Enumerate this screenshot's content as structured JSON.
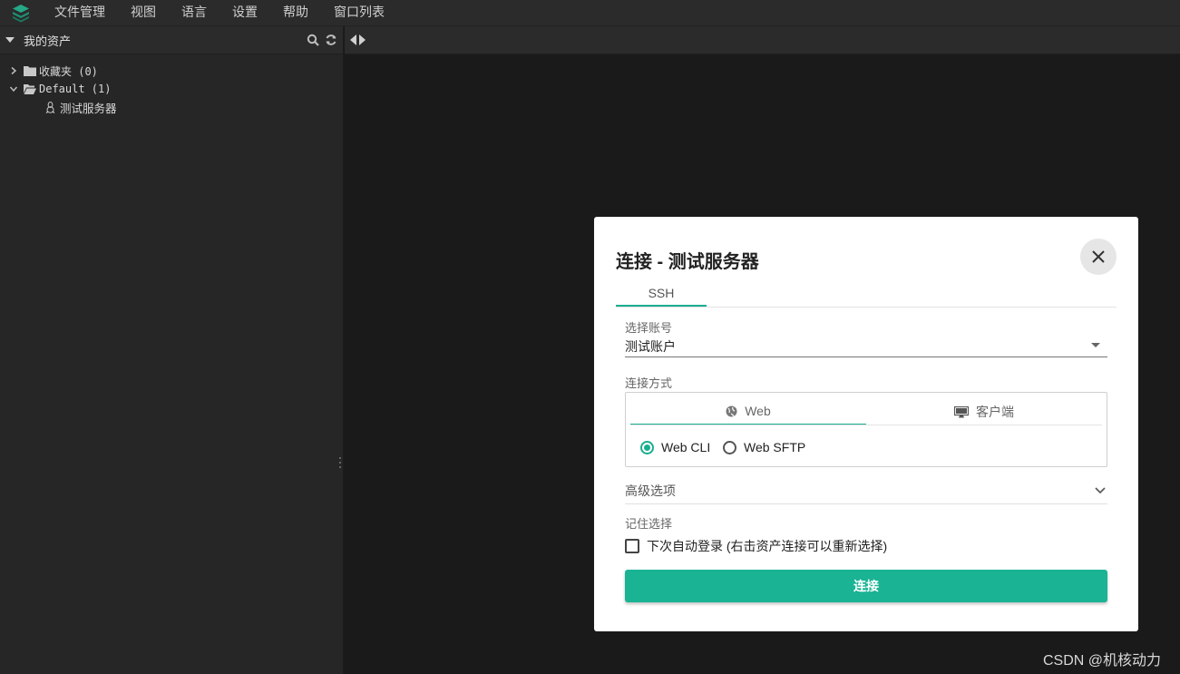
{
  "menubar": {
    "items": [
      "文件管理",
      "视图",
      "语言",
      "设置",
      "帮助",
      "窗口列表"
    ]
  },
  "sidebar": {
    "title": "我的资产",
    "tree": [
      {
        "label": "收藏夹 (0)",
        "expanded": false
      },
      {
        "label": "Default (1)",
        "expanded": true
      },
      {
        "label": "测试服务器",
        "icon": "linux-icon"
      }
    ]
  },
  "modal": {
    "title": "连接 - 测试服务器",
    "tab": "SSH",
    "account_label": "选择账号",
    "account_value": "测试账户",
    "conn_method_label": "连接方式",
    "conn_tabs": [
      "Web",
      "客户端"
    ],
    "radios": [
      "Web CLI",
      "Web SFTP"
    ],
    "selected_radio": "Web CLI",
    "advanced_label": "高级选项",
    "remember_label": "记住选择",
    "auto_login_text": "下次自动登录 (右击资产连接可以重新选择)",
    "connect_label": "连接"
  },
  "watermark": "CSDN @机核动力",
  "colors": {
    "accent": "#1ab394",
    "background": "#1a1a1a",
    "panel": "#262626"
  }
}
